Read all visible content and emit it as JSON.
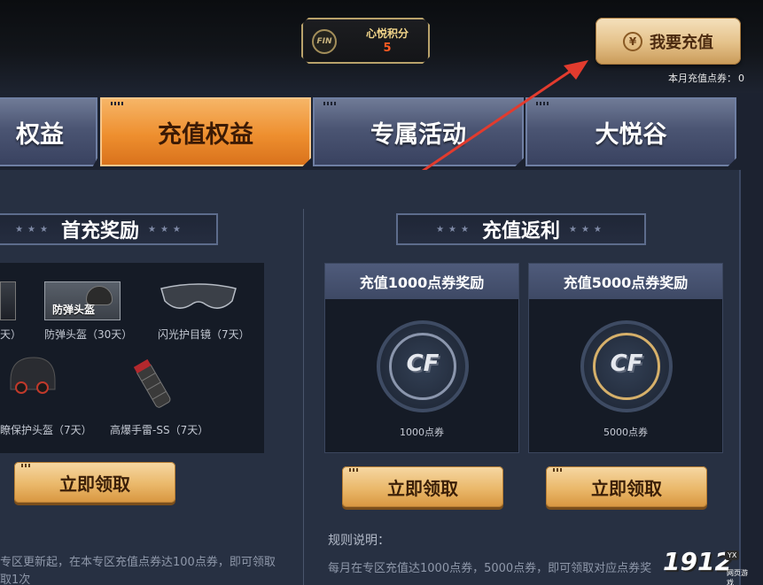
{
  "header": {
    "points_logo": "FIN",
    "points_title": "心悦积分",
    "points_value": "5",
    "recharge_label": "我要充值",
    "coupon_label": "本月充值点券：",
    "coupon_value": "0"
  },
  "tabs": [
    {
      "label": "权益",
      "active": false
    },
    {
      "label": "充值权益",
      "active": true
    },
    {
      "label": "专属活动",
      "active": false
    },
    {
      "label": "大悦谷",
      "active": false
    }
  ],
  "first_charge": {
    "title": "首充奖励",
    "items": [
      {
        "label": "天）",
        "icon": "armor-icon"
      },
      {
        "label": "防弹头盔（30天）",
        "icon": "helmet-icon",
        "card_text": "防弹头盔"
      },
      {
        "label": "闪光护目镜（7天）",
        "icon": "goggles-icon"
      },
      {
        "label": "瞭保护头盔（7天）",
        "icon": "night-vision-helmet-icon"
      },
      {
        "label": "高爆手雷-SS（7天）",
        "icon": "grenade-icon"
      }
    ],
    "claim_label": "立即领取",
    "note_line1": "专区更新起，在本专区充值点券达100点券，即可领取",
    "note_line2": "取1次"
  },
  "rebate": {
    "title": "充值返利",
    "cards": [
      {
        "head": "充值1000点券奖励",
        "caption": "1000点券",
        "claim": "立即领取",
        "coin_text": "CF"
      },
      {
        "head": "充值5000点券奖励",
        "caption": "5000点券",
        "claim": "立即领取",
        "coin_text": "CF"
      }
    ],
    "rules_title": "规则说明：",
    "rules_text": "每月在专区充值达1000点券，5000点券，即可领取对应点券奖"
  },
  "watermark": {
    "number": "1912",
    "badge": "YX",
    "sub": "网页游戏"
  },
  "colors": {
    "accent_orange": "#ee8f2f",
    "gold": "#e4c189",
    "points_value": "#ff5a22",
    "arrow": "#e23b2e"
  }
}
